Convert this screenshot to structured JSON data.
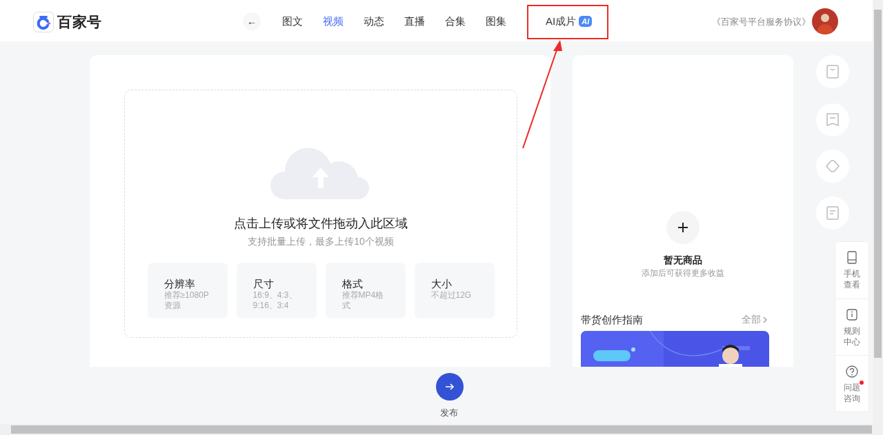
{
  "logo": {
    "text": "百家号"
  },
  "nav": {
    "back_icon": "←",
    "tabs": [
      {
        "label": "图文",
        "selected": false
      },
      {
        "label": "视频",
        "selected": true
      },
      {
        "label": "动态",
        "selected": false
      },
      {
        "label": "直播",
        "selected": false
      },
      {
        "label": "合集",
        "selected": false
      },
      {
        "label": "图集",
        "selected": false
      },
      {
        "label": "AI成片",
        "selected": false,
        "badge": "AI"
      }
    ]
  },
  "agreement": "《百家号平台服务协议》",
  "upload": {
    "title": "点击上传或将文件拖动入此区域",
    "subtitle": "支持批量上传，最多上传10个视频",
    "specs": [
      {
        "title": "分辨率",
        "detail": "推荐≥1080P资源"
      },
      {
        "title": "尺寸",
        "detail": "16:9、4:3、9:16、3:4"
      },
      {
        "title": "格式",
        "detail": "推荐MP4格式"
      },
      {
        "title": "大小",
        "detail": "不超过12G"
      }
    ]
  },
  "publish": {
    "label": "发布"
  },
  "products": {
    "title": "暂无商品",
    "subtitle": "添加后可获得更多收益"
  },
  "guide": {
    "title": "带货创作指南",
    "more": "全部"
  },
  "float_panel": [
    {
      "label": "手机查看",
      "kind": "phone",
      "dot": false
    },
    {
      "label": "规则中心",
      "kind": "info",
      "dot": false
    },
    {
      "label": "问题咨询",
      "kind": "help",
      "dot": true
    }
  ]
}
